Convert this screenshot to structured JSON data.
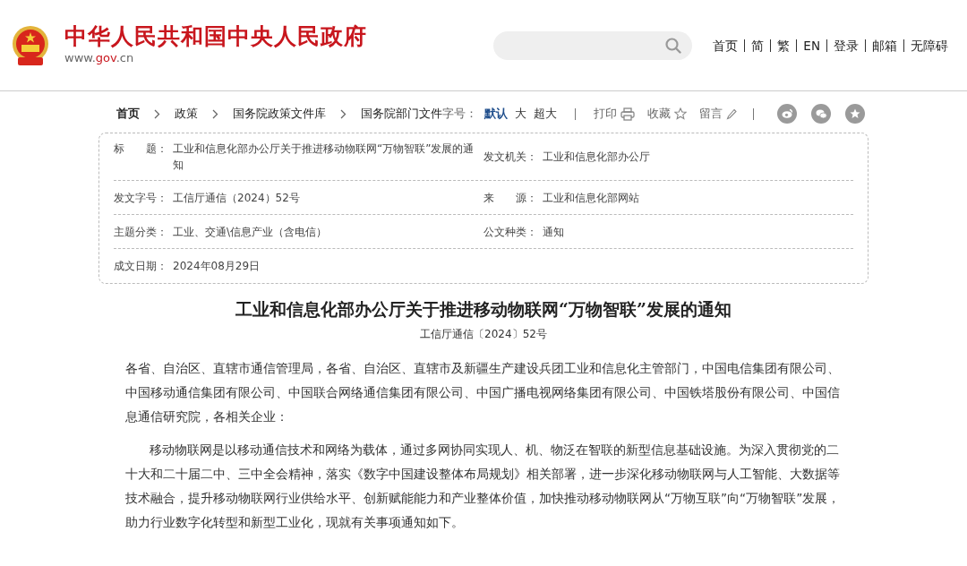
{
  "header": {
    "site_title": "中华人民共和国中央人民政府",
    "site_url": [
      {
        "text": "www.",
        "highlight": false
      },
      {
        "text": "gov",
        "highlight": true
      },
      {
        "text": ".cn",
        "highlight": false
      }
    ],
    "top_links": [
      "首页",
      "简",
      "繁",
      "EN",
      "登录",
      "邮箱",
      "无障碍"
    ]
  },
  "breadcrumb": [
    {
      "label": "首页",
      "bold": true
    },
    {
      "label": "政策",
      "bold": false
    },
    {
      "label": "国务院政策文件库",
      "bold": false
    },
    {
      "label": "国务院部门文件",
      "bold": false
    }
  ],
  "font_size": {
    "label": "字号：",
    "options": [
      {
        "label": "默认",
        "selected": true
      },
      {
        "label": "大",
        "selected": false
      },
      {
        "label": "超大",
        "selected": false
      }
    ]
  },
  "tools": [
    {
      "label": "打印",
      "kind": "print"
    },
    {
      "label": "收藏",
      "kind": "star"
    },
    {
      "label": "留言",
      "kind": "pencil"
    }
  ],
  "info_rows": [
    [
      {
        "label": "标　　题：",
        "value": "工业和信息化部办公厅关于推进移动物联网“万物智联”发展的通知"
      },
      {
        "label": "发文机关：",
        "value": "工业和信息化部办公厅"
      }
    ],
    [
      {
        "label": "发文字号：",
        "value": "工信厅通信（2024）52号"
      },
      {
        "label": "来　　源：",
        "value": "工业和信息化部网站"
      }
    ],
    [
      {
        "label": "主题分类：",
        "value": "工业、交通\\信息产业（含电信）"
      },
      {
        "label": "公文种类：",
        "value": "通知"
      }
    ],
    [
      {
        "label": "成文日期：",
        "value": "2024年08月29日"
      }
    ]
  ],
  "article": {
    "title": "工业和信息化部办公厅关于推进移动物联网“万物智联”发展的通知",
    "doc_number": "工信厅通信〔2024〕52号",
    "paragraphs": [
      {
        "text": "各省、自治区、直辖市通信管理局，各省、自治区、直辖市及新疆生产建设兵团工业和信息化主管部门，中国电信集团有限公司、中国移动通信集团有限公司、中国联合网络通信集团有限公司、中国广播电视网络集团有限公司、中国铁塔股份有限公司、中国信息通信研究院，各相关企业：",
        "indent": false
      },
      {
        "text": "移动物联网是以移动通信技术和网络为载体，通过多网协同实现人、机、物泛在智联的新型信息基础设施。为深入贯彻党的二十大和二十届二中、三中全会精神，落实《数字中国建设整体布局规划》相关部署，进一步深化移动物联网与人工智能、大数据等技术融合，提升移动物联网行业供给水平、创新赋能能力和产业整体价值，加快推动移动物联网从“万物互联”向“万物智联”发展，助力行业数字化转型和新型工业化，现就有关事项通知如下。",
        "indent": true
      }
    ]
  }
}
